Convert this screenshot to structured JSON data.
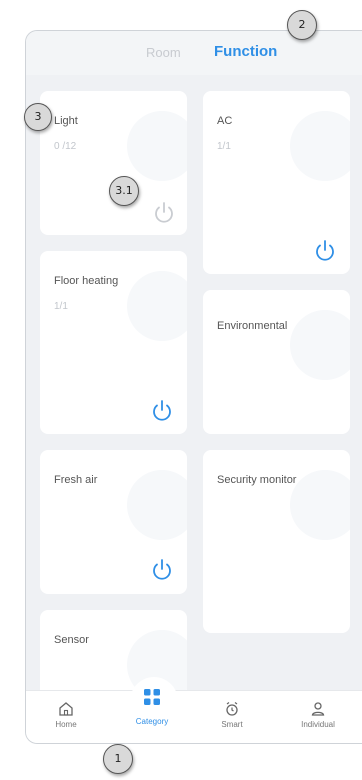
{
  "tabs": {
    "room": "Room",
    "function": "Function"
  },
  "cards": {
    "light": {
      "title": "Light",
      "count": "0 /12"
    },
    "ac": {
      "title": "AC",
      "count": "1/1"
    },
    "floor": {
      "title": "Floor heating",
      "count": "1/1"
    },
    "env": {
      "title": "Environmental"
    },
    "fresh": {
      "title": "Fresh air"
    },
    "security": {
      "title": "Security monitor"
    },
    "sensor": {
      "title": "Sensor"
    }
  },
  "nav": {
    "home": "Home",
    "category": "Category",
    "smart": "Smart",
    "individual": "Individual"
  },
  "annotations": {
    "a1": "1",
    "a2": "2",
    "a3": "3",
    "a31": "3.1"
  },
  "colors": {
    "accent": "#2f8fe6",
    "background": "#eff1f4",
    "card": "#ffffff"
  }
}
